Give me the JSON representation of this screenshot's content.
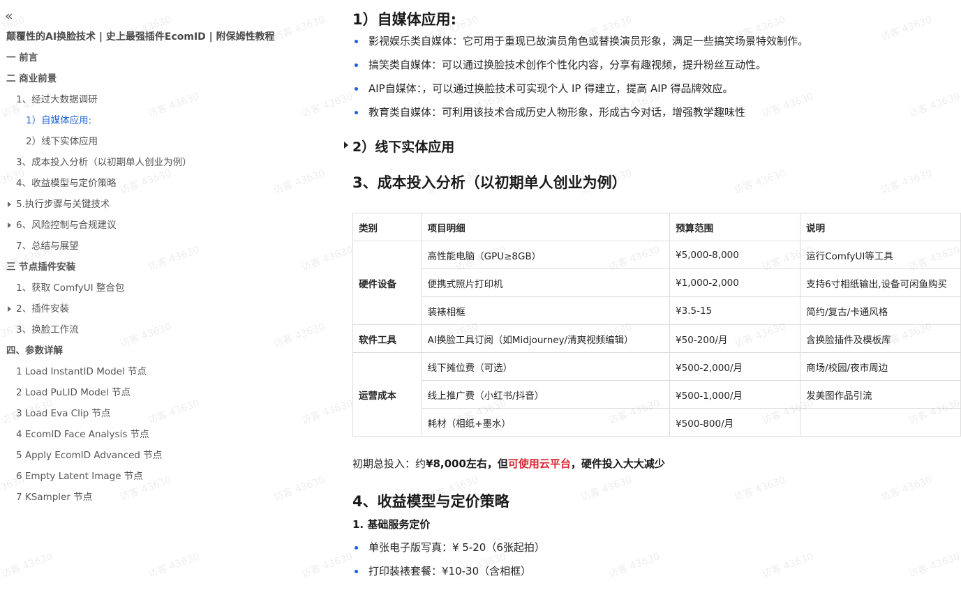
{
  "toc": {
    "collapse_icon": "«",
    "title": "颠覆性的AI换脸技术 | 史上最强插件EcomID | 附保姆性教程",
    "items": [
      {
        "label": "一 前言",
        "level": 1
      },
      {
        "label": "二 商业前景",
        "level": 1
      },
      {
        "label": "1、经过大数据调研",
        "level": 2
      },
      {
        "label": "1）自媒体应用:",
        "level": 3,
        "active": true
      },
      {
        "label": "2）线下实体应用",
        "level": 3
      },
      {
        "label": "3、成本投入分析（以初期单人创业为例）",
        "level": 2
      },
      {
        "label": "4、收益模型与定价策略",
        "level": 2
      },
      {
        "label": "5.执行步骤与关键技术",
        "level": 2,
        "collapsed": true
      },
      {
        "label": "6、风险控制与合规建议",
        "level": 2,
        "collapsed": true
      },
      {
        "label": "7、总结与展望",
        "level": 2
      },
      {
        "label": "三 节点插件安装",
        "level": 1
      },
      {
        "label": "1、获取 ComfyUI 整合包",
        "level": 2
      },
      {
        "label": "2、插件安装",
        "level": 2,
        "collapsed": true
      },
      {
        "label": "3、换脸工作流",
        "level": 2
      },
      {
        "label": "四、参数详解",
        "level": 1
      },
      {
        "label": "1 Load InstantID Model 节点",
        "level": 2
      },
      {
        "label": "2 Load PuLID Model 节点",
        "level": 2
      },
      {
        "label": "3 Load Eva Clip 节点",
        "level": 2
      },
      {
        "label": "4 EcomID Face Analysis 节点",
        "level": 2
      },
      {
        "label": "5 Apply EcomID Advanced 节点",
        "level": 2
      },
      {
        "label": "6 Empty Latent Image 节点",
        "level": 2
      },
      {
        "label": "7 KSampler 节点",
        "level": 2
      }
    ]
  },
  "content": {
    "section_media": {
      "heading": "1）自媒体应用:",
      "bullets": [
        "影视娱乐类自媒体：它可用于重现已故演员角色或替换演员形象，满足一些搞笑场景特效制作。",
        "搞笑类自媒体：可以通过换脸技术创作个性化内容，分享有趣视频，提升粉丝互动性。",
        "AIP自媒体：，可以通过换脸技术可实现个人 IP 得建立，提高 AIP 得品牌效应。",
        "教育类自媒体：可利用该技术合成历史人物形象，形成古今对话，增强教学趣味性"
      ]
    },
    "section_offline": {
      "heading": "2）线下实体应用"
    },
    "section_cost": {
      "heading": "3、成本投入分析（以初期单人创业为例）",
      "table": {
        "headers": [
          "类别",
          "项目明细",
          "预算范围",
          "说明"
        ],
        "groups": [
          {
            "category": "硬件设备",
            "rows": [
              [
                "高性能电脑（GPU≥8GB）",
                "¥5,000-8,000",
                "运行ComfyUI等工具"
              ],
              [
                "便携式照片打印机",
                "¥1,000-2,000",
                "支持6寸相纸输出,设备可闲鱼购买"
              ],
              [
                "装裱相框",
                "¥3.5-15",
                "简约/复古/卡通风格"
              ]
            ]
          },
          {
            "category": "软件工具",
            "rows": [
              [
                "AI换脸工具订阅（如Midjourney/清爽视频编辑）",
                "¥50-200/月",
                "含换脸插件及模板库"
              ]
            ]
          },
          {
            "category": "运营成本",
            "rows": [
              [
                "线下摊位费（可选）",
                "¥500-2,000/月",
                "商场/校园/夜市周边"
              ],
              [
                "线上推广费（小红书/抖音）",
                "¥500-1,000/月",
                "发美图作品引流"
              ],
              [
                "耗材（相纸+墨水）",
                "¥500-800/月",
                ""
              ]
            ]
          }
        ]
      },
      "summary": {
        "prefix": "初期总投入：约",
        "bold1": "¥8,000左右，但",
        "red": "可使用云平台",
        "bold2": "，硬件投入大大减少"
      }
    },
    "section_revenue": {
      "heading": "4、收益模型与定价策略",
      "subheading": "1. 基础服务定价",
      "bullets": [
        "单张电子版写真：¥ 5-20（6张起拍）",
        "打印装裱套餐：¥10-30（含相框）"
      ]
    },
    "watermark": "访客 43630"
  }
}
